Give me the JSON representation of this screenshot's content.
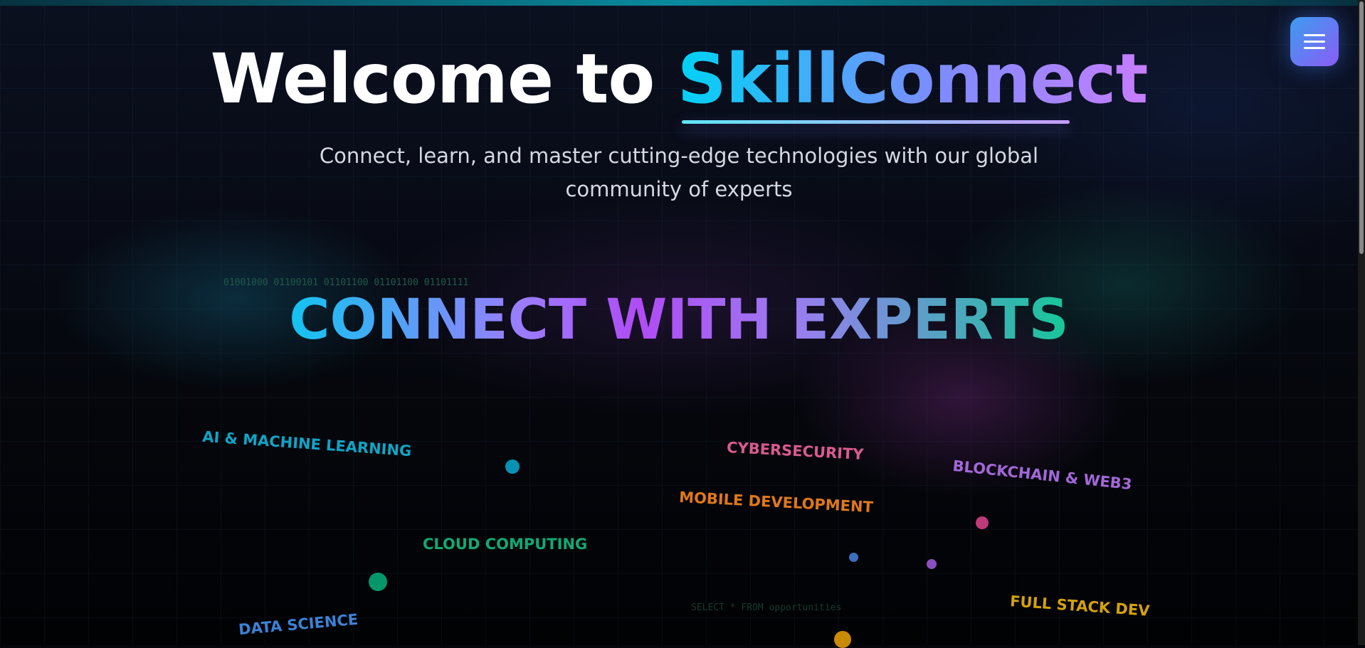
{
  "header": {
    "title_prefix": "Welcome to",
    "title_brand": "SkillConnect",
    "subtitle": "Connect, learn, and master cutting-edge technologies with our global community of experts"
  },
  "menu": {
    "icon": "hamburger-menu-icon"
  },
  "decor": {
    "binary": "01001000 01100101 01101100 01101100 01101111",
    "sql": "SELECT * FROM opportunities"
  },
  "section": {
    "title": "CONNECT WITH EXPERTS"
  },
  "skills": [
    {
      "label": "AI & MACHINE LEARNING",
      "color": "#0ea5c6"
    },
    {
      "label": "CYBERSECURITY",
      "color": "#db5a8f"
    },
    {
      "label": "BLOCKCHAIN & WEB3",
      "color": "#a367d8"
    },
    {
      "label": "MOBILE DEVELOPMENT",
      "color": "#e0781a"
    },
    {
      "label": "CLOUD COMPUTING",
      "color": "#10a974"
    },
    {
      "label": "DATA SCIENCE",
      "color": "#3b82d6"
    },
    {
      "label": "FULL STACK DEV",
      "color": "#d4a20a"
    }
  ]
}
